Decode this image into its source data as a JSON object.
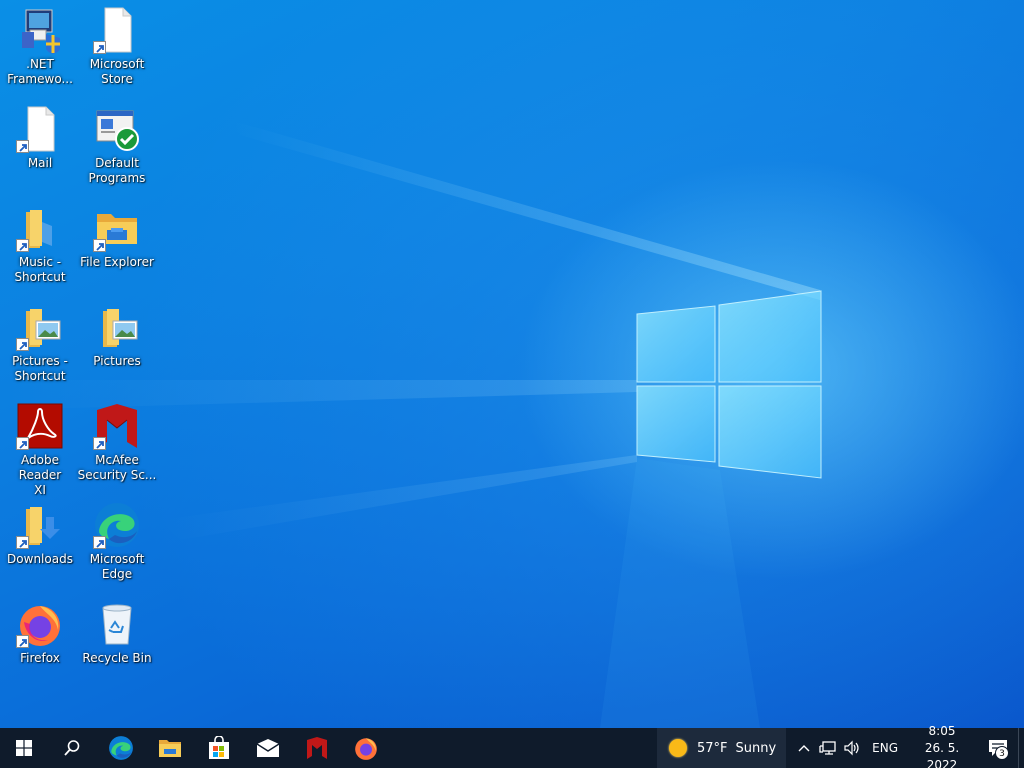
{
  "desktop": {
    "icons": [
      {
        "label": ".NET\nFramewo...",
        "icon": "dotnet-installer-icon"
      },
      {
        "label": "Microsoft\nStore",
        "icon": "blank-file-icon"
      },
      {
        "label": "Mail",
        "icon": "blank-file-icon"
      },
      {
        "label": "Default\nPrograms",
        "icon": "default-programs-icon"
      },
      {
        "label": "Music -\nShortcut",
        "icon": "folder-icon"
      },
      {
        "label": "File Explorer",
        "icon": "file-explorer-icon"
      },
      {
        "label": "Pictures -\nShortcut",
        "icon": "pictures-folder-icon"
      },
      {
        "label": "Pictures",
        "icon": "pictures-folder-icon"
      },
      {
        "label": "Adobe Reader\nXI",
        "icon": "adobe-reader-icon"
      },
      {
        "label": "McAfee\nSecurity Sc...",
        "icon": "mcafee-icon"
      },
      {
        "label": "Downloads",
        "icon": "downloads-folder-icon"
      },
      {
        "label": "Microsoft\nEdge",
        "icon": "edge-icon"
      },
      {
        "label": "Firefox",
        "icon": "firefox-icon"
      },
      {
        "label": "Recycle Bin",
        "icon": "recycle-bin-icon"
      }
    ]
  },
  "taskbar": {
    "weather": {
      "temp": "57°F",
      "condition": "Sunny"
    },
    "language": "ENG",
    "clock": {
      "time": "8:05",
      "date": "26. 5. 2022"
    },
    "notification_count": "3"
  },
  "colors": {
    "taskbar_bg": "#0f1b2b",
    "desktop_accent": "#0a7fe0"
  }
}
